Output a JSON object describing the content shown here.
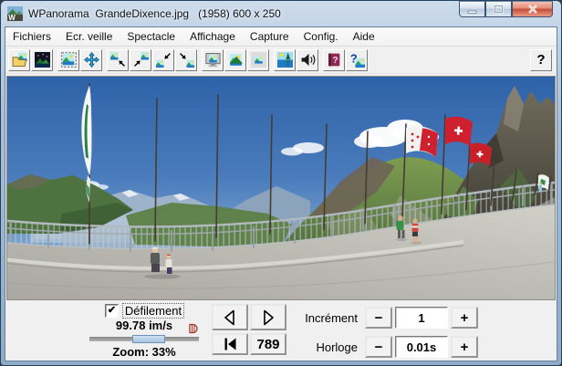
{
  "window": {
    "title": "WPanorama  GrandeDixence.jpg   (1958) 600 x 250",
    "icon_letter": "W"
  },
  "menu": {
    "items": [
      {
        "label": "Fichiers"
      },
      {
        "label": "Ecr. veille"
      },
      {
        "label": "Spectacle"
      },
      {
        "label": "Affichage"
      },
      {
        "label": "Capture"
      },
      {
        "label": "Config."
      },
      {
        "label": "Aide"
      }
    ]
  },
  "toolbar": {
    "icons": [
      "open-image",
      "night-mode",
      "image-frame",
      "pan-arrows",
      "scroll-up-left",
      "scroll-up-right",
      "scroll-down-left",
      "scroll-down-right",
      "fullscreen",
      "fit-window",
      "thumbnail-bar",
      "slideshow",
      "sound",
      "help-book",
      "context-help"
    ],
    "help_label": "?"
  },
  "controls": {
    "defilement": {
      "label": "Défilement",
      "checked": true,
      "check_glyph": "✔"
    },
    "speed": "99.78 im/s",
    "zoom": "Zoom: 33%",
    "frame": "789",
    "increment": {
      "label": "Incrément",
      "value": "1"
    },
    "clock": {
      "label": "Horloge",
      "value": "0.01s"
    },
    "minus": "−",
    "plus": "+"
  }
}
